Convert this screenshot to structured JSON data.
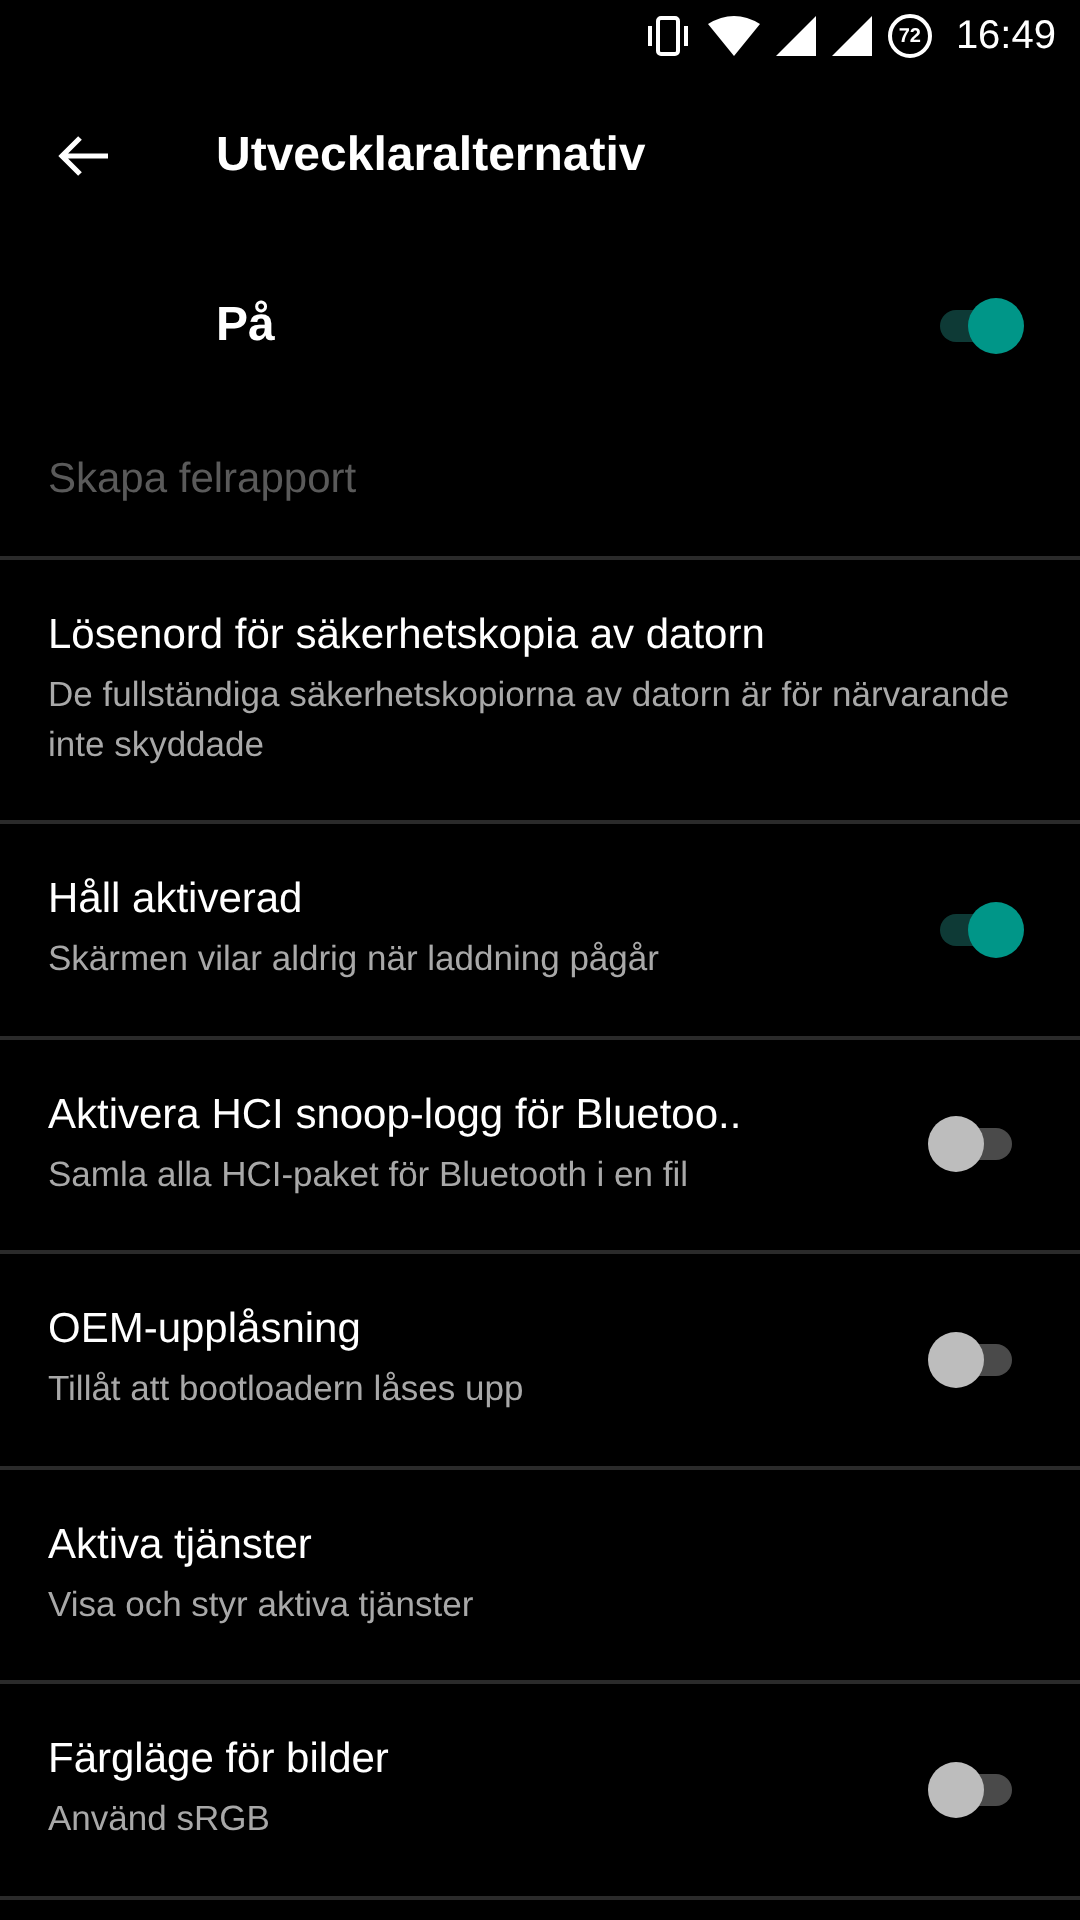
{
  "status_bar": {
    "battery": "72",
    "time": "16:49"
  },
  "toolbar": {
    "title": "Utvecklaralternativ"
  },
  "master_switch": {
    "label": "På",
    "on": true
  },
  "settings": [
    {
      "kind": "plain",
      "title": "Skapa felrapport",
      "disabled": true
    },
    {
      "kind": "plain",
      "title": "Lösenord för säkerhetskopia av datorn",
      "summary": "De fullständiga säkerhetskopiorna av datorn är för närvarande inte skyddade",
      "disabled": false
    },
    {
      "kind": "switch",
      "title": "Håll aktiverad",
      "summary": "Skärmen vilar aldrig när laddning pågår",
      "on": true,
      "disabled": false
    },
    {
      "kind": "switch",
      "title": "Aktivera HCI snoop-logg för Bluetoo..",
      "summary": "Samla alla HCI-paket för Bluetooth i en fil",
      "on": false,
      "disabled": false
    },
    {
      "kind": "switch",
      "title": "OEM-upplåsning",
      "summary": "Tillåt att bootloadern låses upp",
      "on": false,
      "disabled": false
    },
    {
      "kind": "plain",
      "title": "Aktiva tjänster",
      "summary": "Visa och styr aktiva tjänster",
      "disabled": false
    },
    {
      "kind": "switch",
      "title": "Färgläge för bilder",
      "summary": "Använd sRGB",
      "on": false,
      "disabled": false
    }
  ]
}
